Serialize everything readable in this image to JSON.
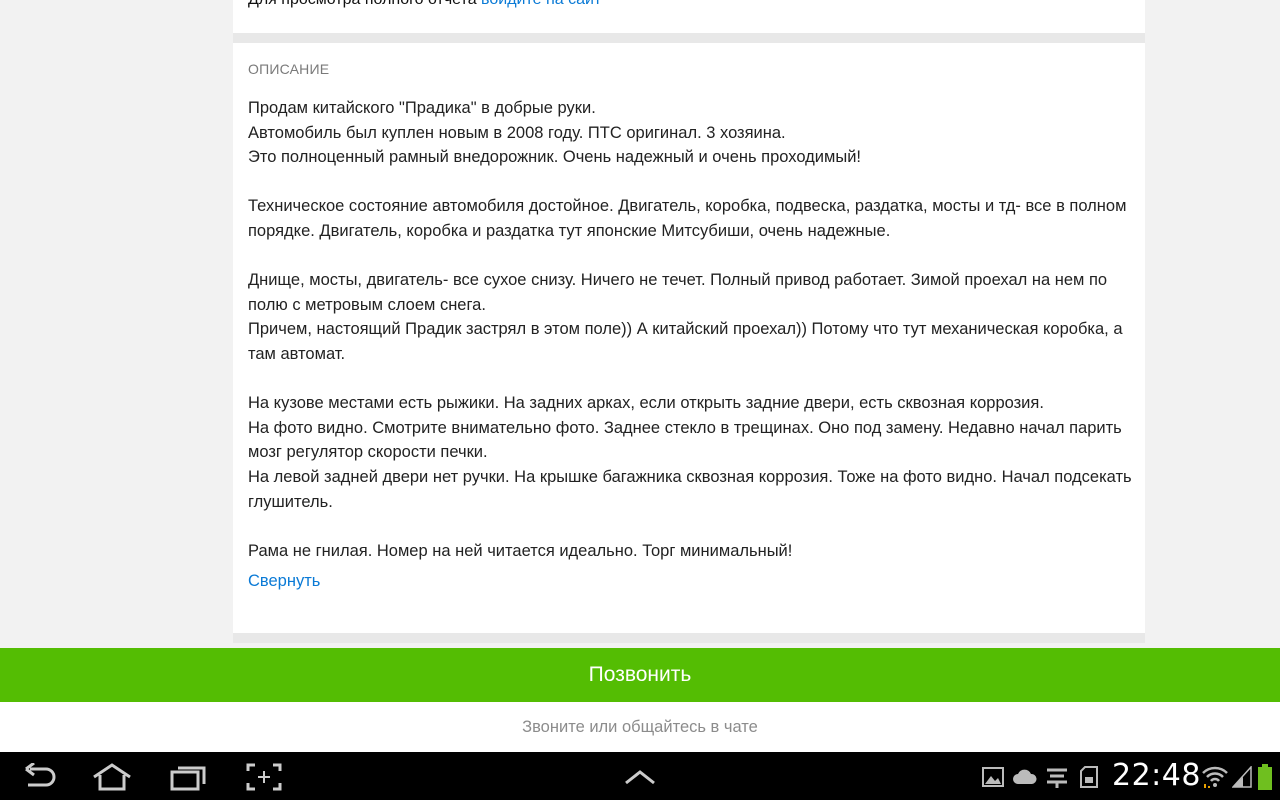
{
  "report": {
    "prefix": "Для просмотра полного отчета",
    "link": "войдите на сайт"
  },
  "description": {
    "title": "ОПИСАНИЕ",
    "lines": [
      "Продам китайского \"Прадика\" в добрые руки.",
      "Автомобиль был куплен новым в 2008 году. ПТС оригинал. 3 хозяина.",
      "Это полноценный рамный внедорожник. Очень надежный и очень проходимый!",
      "",
      "Техническое состояние автомобиля достойное. Двигатель, коробка, подвеска, раздатка, мосты и тд- все в полном порядке. Двигатель, коробка и раздатка тут японские Митсубиши, очень надежные.",
      "",
      "Днище, мосты, двигатель- все сухое снизу. Ничего не течет. Полный привод работает. Зимой проехал на нем по полю с метровым слоем снега.",
      "Причем, настоящий Прадик застрял в этом поле)) А китайский проехал)) Потому что тут механическая коробка, а там автомат.",
      "",
      "На кузове местами есть рыжики. На задних арках, если открыть задние двери, есть сквозная коррозия.",
      "На фото видно. Смотрите внимательно фото. Заднее стекло в трещинах. Оно под замену. Недавно начал парить мозг регулятор скорости печки.",
      "На левой задней двери нет ручки. На крышке багажника сквозная коррозия. Тоже на фото видно. Начал подсекать глушитель.",
      "",
      "Рама не гнилая. Номер на ней читается идеально. Торг минимальный!"
    ],
    "collapse_label": "Свернуть"
  },
  "actions": {
    "call_label": "Позвонить",
    "hint": "Звоните или общайтесь в чате"
  },
  "system_bar": {
    "time": "22:48",
    "icons": [
      "back-icon",
      "home-icon",
      "recent-apps-icon",
      "screenshot-icon",
      "menu-up-icon",
      "gallery-icon",
      "cloud-icon",
      "notification-icon",
      "sd-card-icon",
      "wifi-icon",
      "signal-icon",
      "battery-icon"
    ]
  },
  "colors": {
    "accent_green": "#54bd03",
    "link_blue": "#0a7ad6",
    "background": "#f2f2f2"
  }
}
